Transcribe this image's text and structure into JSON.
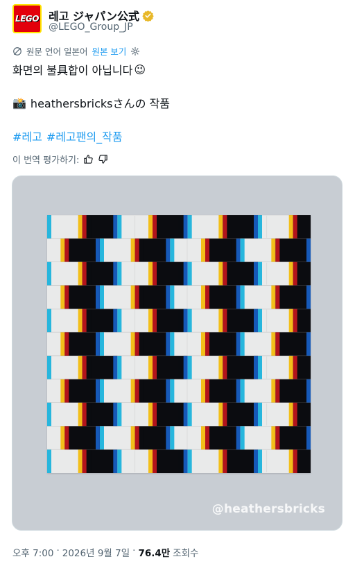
{
  "account": {
    "display_name": "레고 ジャパン公式",
    "handle": "@LEGO_Group_JP",
    "logo_text": "LEGO",
    "verified_badge_icon": "gold-verified-badge-icon"
  },
  "translation": {
    "label": "원문 언어 일본어",
    "show_original": "원본 보기"
  },
  "tweet": {
    "line1": "화면의 불具합이 아닙니다",
    "line1_emoji": "😉",
    "line2_emoji": "📸",
    "line2": "heathersbricksさんの 작품",
    "hashtags": [
      "#레고",
      "#레고팬의_작품"
    ]
  },
  "rate": {
    "label": "이 번역 평가하기:"
  },
  "media": {
    "watermark": "@heathersbricks",
    "rows": 11,
    "cols": 7,
    "colors": {
      "black": "#0b0c10",
      "white": "#e9eaea",
      "cyan": "#27b6dd",
      "blue": "#1659b8",
      "red": "#b3141b",
      "yellow": "#f3bf1a"
    }
  },
  "meta": {
    "time": "오후 7:00",
    "date": "2026년 9월 7일",
    "views_count": "76.4만",
    "views_label": "조회수"
  }
}
